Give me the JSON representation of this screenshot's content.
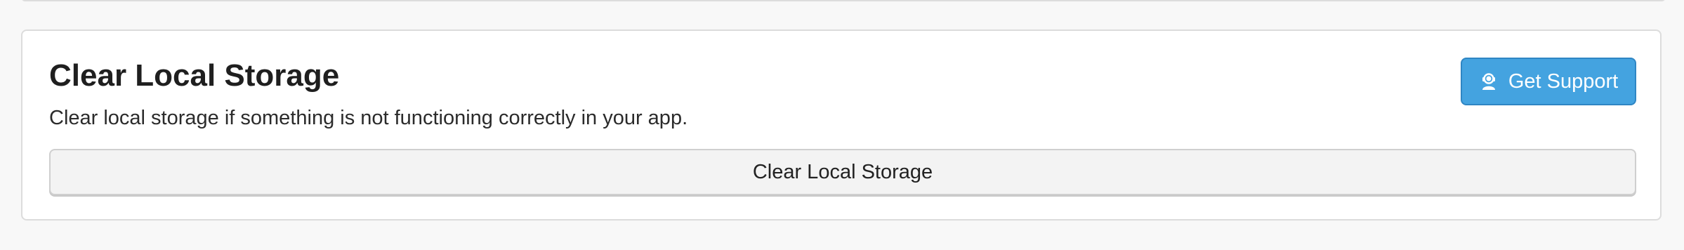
{
  "card": {
    "title": "Clear Local Storage",
    "description": "Clear local storage if something is not functioning correctly in your app."
  },
  "support_button": {
    "label": "Get Support",
    "icon": "headset-agent-icon"
  },
  "clear_button": {
    "label": "Clear Local Storage"
  },
  "colors": {
    "accent": "#44a3e0",
    "accent_border": "#2f86c4",
    "card_border": "#dcdcdc",
    "background": "#f8f8f8"
  }
}
